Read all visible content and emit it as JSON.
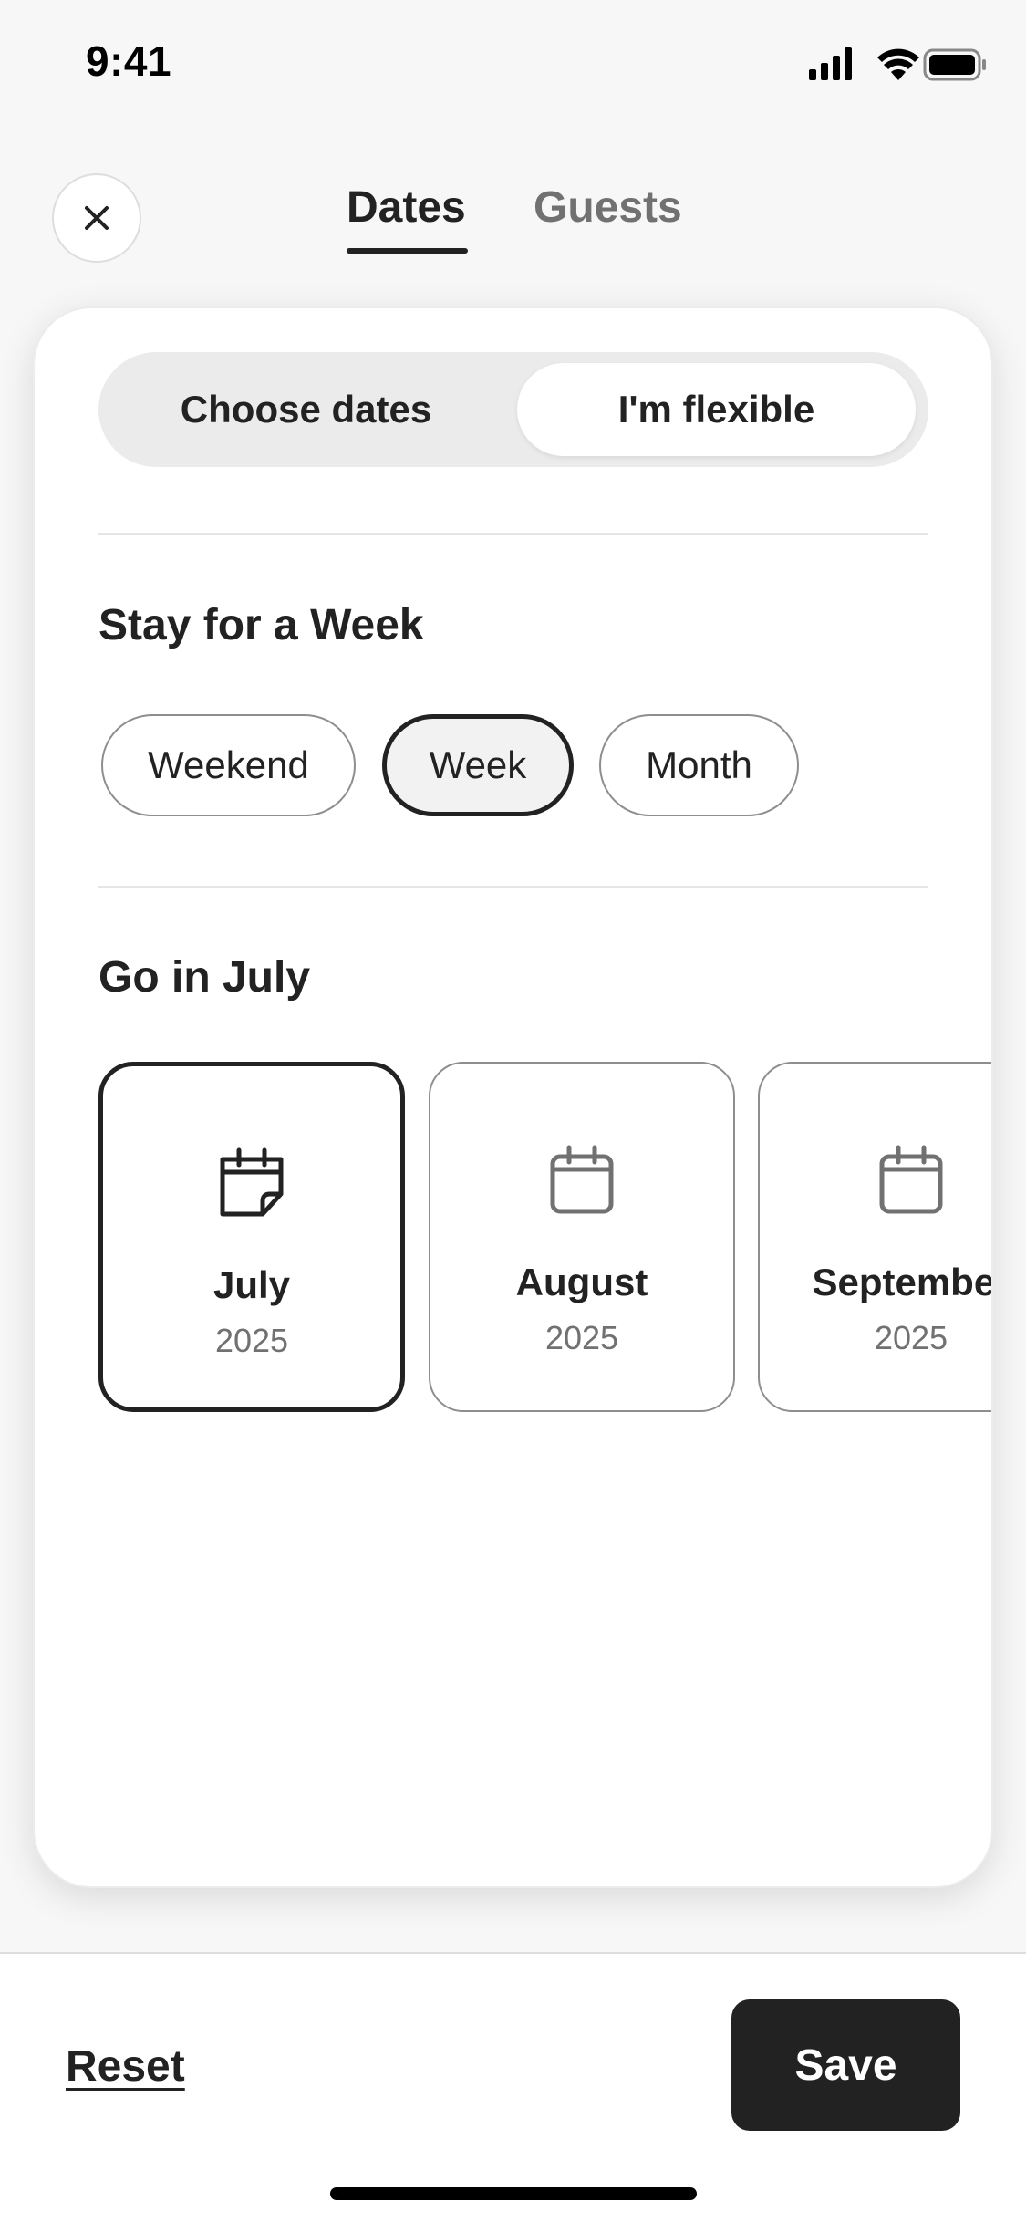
{
  "status_bar": {
    "time": "9:41",
    "icons": [
      "cellular-signal-icon",
      "wifi-icon",
      "battery-icon"
    ]
  },
  "header": {
    "close_icon": "close-icon",
    "tabs": [
      {
        "label": "Dates",
        "active": true
      },
      {
        "label": "Guests",
        "active": false
      }
    ]
  },
  "mode_toggle": {
    "options": [
      {
        "label": "Choose dates",
        "selected": false
      },
      {
        "label": "I'm flexible",
        "selected": true
      }
    ]
  },
  "stay_section": {
    "title": "Stay for a Week",
    "options": [
      {
        "label": "Weekend",
        "selected": false
      },
      {
        "label": "Week",
        "selected": true
      },
      {
        "label": "Month",
        "selected": false
      }
    ]
  },
  "month_section": {
    "title": "Go in July",
    "months": [
      {
        "name": "July",
        "year": "2025",
        "selected": true,
        "icon": "calendar-page-curl-icon"
      },
      {
        "name": "August",
        "year": "2025",
        "selected": false,
        "icon": "calendar-icon"
      },
      {
        "name": "September",
        "year": "2025",
        "selected": false,
        "icon": "calendar-icon"
      }
    ]
  },
  "footer": {
    "reset_label": "Reset",
    "save_label": "Save"
  },
  "colors": {
    "text_primary": "#222222",
    "text_secondary": "#717171",
    "background": "#f7f7f7",
    "card": "#ffffff",
    "button_dark": "#222222"
  }
}
